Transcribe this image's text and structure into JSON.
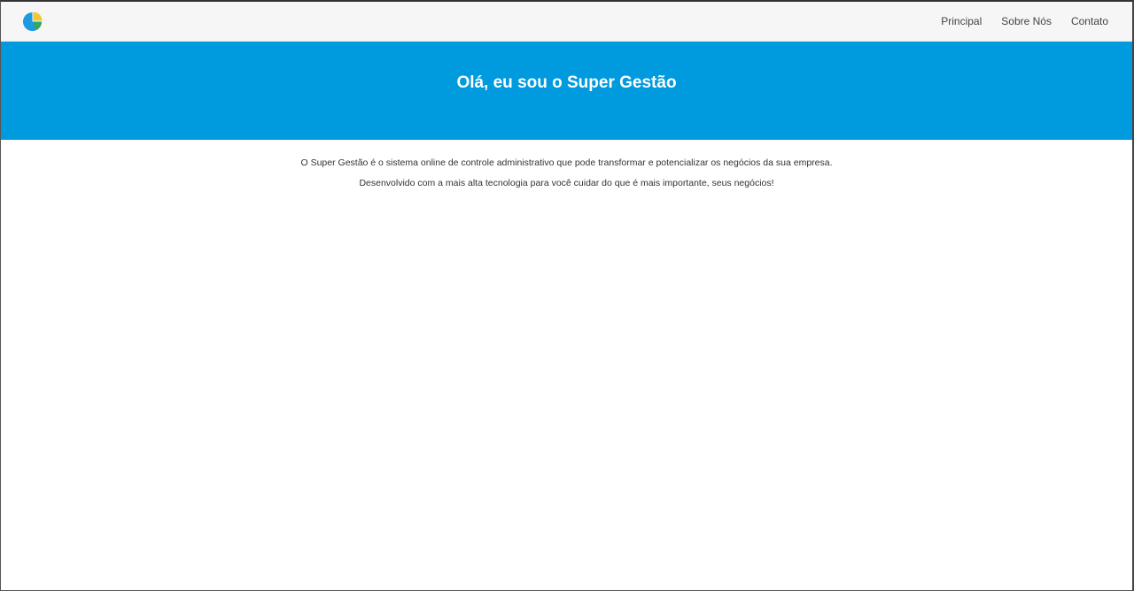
{
  "header": {
    "logo_icon": "pie-chart-icon",
    "nav": [
      {
        "label": "Principal"
      },
      {
        "label": "Sobre Nós"
      },
      {
        "label": "Contato"
      }
    ]
  },
  "banner": {
    "title": "Olá, eu sou o Super Gestão",
    "background_color": "#009ade"
  },
  "content": {
    "paragraphs": [
      "O Super Gestão é o sistema online de controle administrativo que pode transformar e potencializar os negócios da sua empresa.",
      "Desenvolvido com a mais alta tecnologia para você cuidar do que é mais importante, seus negócios!"
    ]
  },
  "colors": {
    "logo_blue": "#1e9be0",
    "logo_yellow": "#f4c534",
    "logo_green": "#3aa84a"
  }
}
